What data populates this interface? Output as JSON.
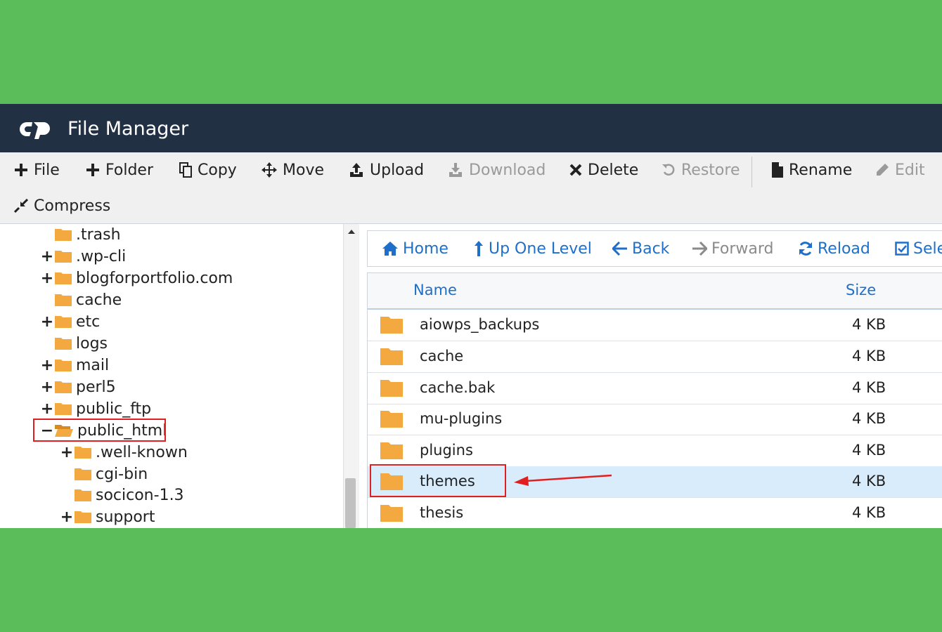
{
  "app": {
    "title": "File Manager",
    "logo": "cP"
  },
  "toolbar": [
    {
      "label": "File",
      "icon": "plus-icon",
      "enabled": true
    },
    {
      "label": "Folder",
      "icon": "plus-icon",
      "enabled": true
    },
    {
      "label": "Copy",
      "icon": "copy-icon",
      "enabled": true
    },
    {
      "label": "Move",
      "icon": "move-icon",
      "enabled": true
    },
    {
      "label": "Upload",
      "icon": "upload-icon",
      "enabled": true
    },
    {
      "label": "Download",
      "icon": "download-icon",
      "enabled": false
    },
    {
      "label": "Delete",
      "icon": "close-icon",
      "enabled": true
    },
    {
      "label": "Restore",
      "icon": "undo-icon",
      "enabled": false
    },
    {
      "label": "Rename",
      "icon": "document-icon",
      "enabled": true
    },
    {
      "label": "Edit",
      "icon": "pencil-icon",
      "enabled": false
    },
    {
      "label": "Compress",
      "icon": "compress-icon",
      "enabled": true
    }
  ],
  "tree": [
    {
      "label": ".trash",
      "expander": "",
      "open": false
    },
    {
      "label": ".wp-cli",
      "expander": "+",
      "open": false
    },
    {
      "label": "blogforportfolio.com",
      "expander": "+",
      "open": false
    },
    {
      "label": "cache",
      "expander": "",
      "open": false
    },
    {
      "label": "etc",
      "expander": "+",
      "open": false
    },
    {
      "label": "logs",
      "expander": "",
      "open": false
    },
    {
      "label": "mail",
      "expander": "+",
      "open": false
    },
    {
      "label": "perl5",
      "expander": "+",
      "open": false
    },
    {
      "label": "public_ftp",
      "expander": "+",
      "open": false
    },
    {
      "label": "public_html",
      "expander": "−",
      "open": true,
      "selected": true
    },
    {
      "label": ".well-known",
      "expander": "+",
      "open": false
    },
    {
      "label": "cgi-bin",
      "expander": "",
      "open": false
    },
    {
      "label": "socicon-1.3",
      "expander": "",
      "open": false
    },
    {
      "label": "support",
      "expander": "+",
      "open": false
    }
  ],
  "nav": [
    {
      "label": "Home",
      "icon": "home-icon",
      "enabled": true
    },
    {
      "label": "Up One Level",
      "icon": "arrow-up-icon",
      "enabled": true
    },
    {
      "label": "Back",
      "icon": "arrow-left-icon",
      "enabled": true
    },
    {
      "label": "Forward",
      "icon": "arrow-right-icon",
      "enabled": false
    },
    {
      "label": "Reload",
      "icon": "refresh-icon",
      "enabled": true
    },
    {
      "label": "Sele",
      "icon": "checkbox-icon",
      "enabled": true
    }
  ],
  "grid": {
    "columns": [
      "Name",
      "Size"
    ],
    "rows": [
      {
        "name": "aiowps_backups",
        "size": "4 KB"
      },
      {
        "name": "cache",
        "size": "4 KB"
      },
      {
        "name": "cache.bak",
        "size": "4 KB"
      },
      {
        "name": "mu-plugins",
        "size": "4 KB"
      },
      {
        "name": "plugins",
        "size": "4 KB"
      },
      {
        "name": "themes",
        "size": "4 KB",
        "highlighted": true
      },
      {
        "name": "thesis",
        "size": "4 KB"
      }
    ]
  },
  "colors": {
    "background": "#5bbd5a",
    "header": "#213043",
    "link": "#1e6fc9",
    "folder": "#f3a940",
    "highlight": "#d9ecfb",
    "annotation": "#e02020"
  }
}
